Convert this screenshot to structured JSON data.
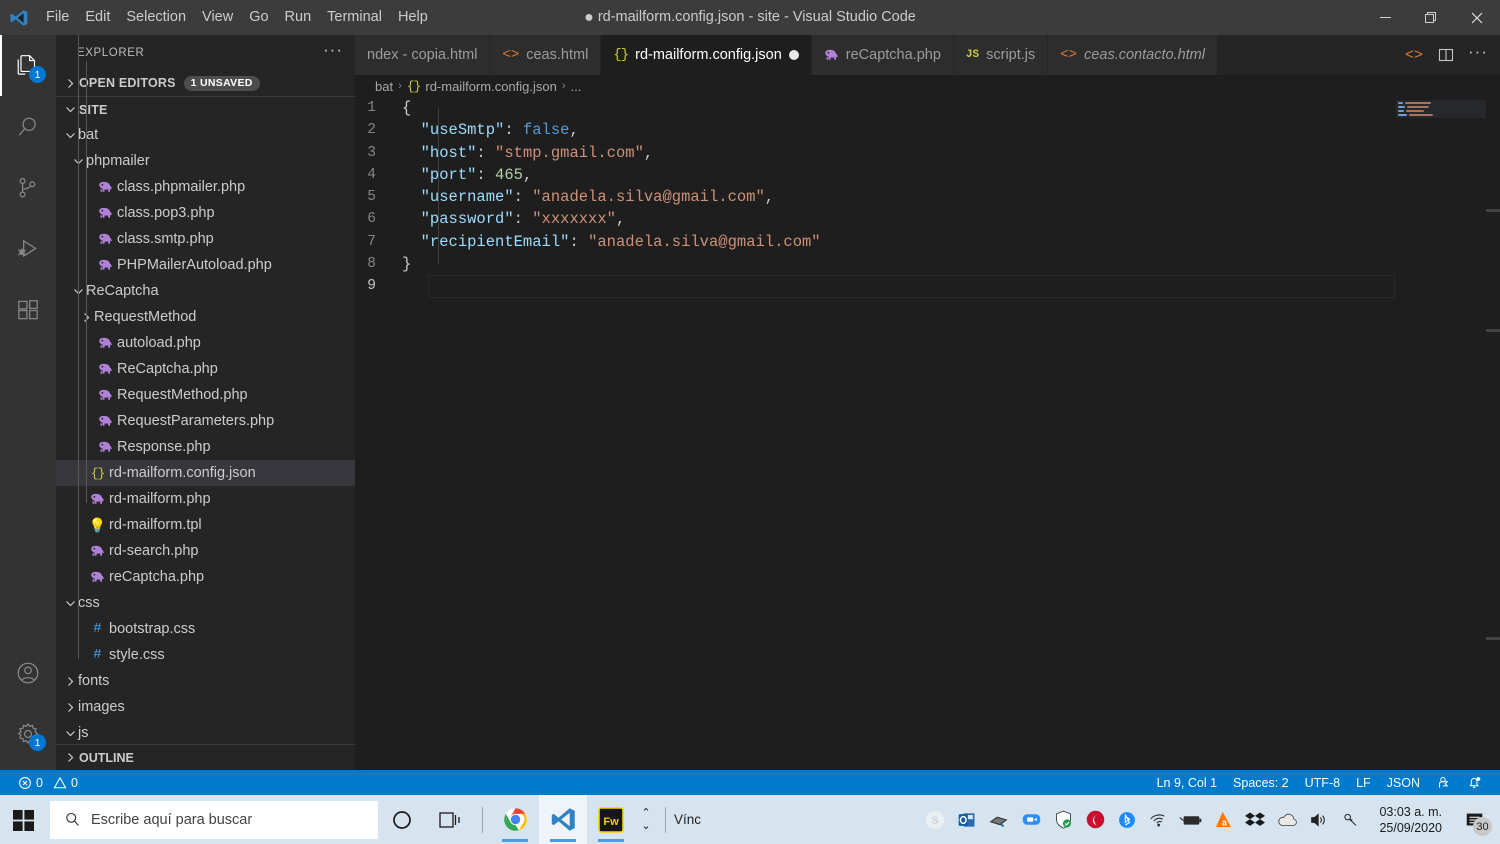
{
  "window": {
    "title": "rd-mailform.config.json - site - Visual Studio Code",
    "dirty_marker": "●",
    "minimize": "─",
    "restore": "❐",
    "close": "✕"
  },
  "menubar": {
    "items": [
      "File",
      "Edit",
      "Selection",
      "View",
      "Go",
      "Run",
      "Terminal",
      "Help"
    ]
  },
  "activitybar": {
    "items": [
      {
        "name": "explorer",
        "badge": "1",
        "active": true
      },
      {
        "name": "search",
        "badge": "",
        "active": false
      },
      {
        "name": "source-control",
        "badge": "",
        "active": false
      },
      {
        "name": "run-and-debug",
        "badge": "",
        "active": false
      },
      {
        "name": "extensions",
        "badge": "",
        "active": false
      }
    ],
    "bottom": [
      {
        "name": "accounts",
        "badge": ""
      },
      {
        "name": "manage-settings",
        "badge": "1"
      }
    ]
  },
  "sidebar": {
    "title": "EXPLORER",
    "more_actions": "···",
    "open_editors": {
      "label": "OPEN EDITORS",
      "chip": "1 UNSAVED",
      "expanded": false
    },
    "root": {
      "label": "SITE",
      "expanded": true
    },
    "outline": {
      "label": "OUTLINE",
      "expanded": false
    },
    "tree": [
      {
        "label": "bat",
        "type": "folder",
        "expanded": true,
        "depth": 1
      },
      {
        "label": "phpmailer",
        "type": "folder",
        "expanded": true,
        "depth": 2
      },
      {
        "label": "class.phpmailer.php",
        "type": "php",
        "depth": 3
      },
      {
        "label": "class.pop3.php",
        "type": "php",
        "depth": 3
      },
      {
        "label": "class.smtp.php",
        "type": "php",
        "depth": 3
      },
      {
        "label": "PHPMailerAutoload.php",
        "type": "php",
        "depth": 3
      },
      {
        "label": "ReCaptcha",
        "type": "folder",
        "expanded": true,
        "depth": 2
      },
      {
        "label": "RequestMethod",
        "type": "folder",
        "expanded": false,
        "depth": 3
      },
      {
        "label": "autoload.php",
        "type": "php",
        "depth": 3
      },
      {
        "label": "ReCaptcha.php",
        "type": "php",
        "depth": 3
      },
      {
        "label": "RequestMethod.php",
        "type": "php",
        "depth": 3
      },
      {
        "label": "RequestParameters.php",
        "type": "php",
        "depth": 3
      },
      {
        "label": "Response.php",
        "type": "php",
        "depth": 3
      },
      {
        "label": "rd-mailform.config.json",
        "type": "json",
        "depth": 2,
        "selected": true
      },
      {
        "label": "rd-mailform.php",
        "type": "php",
        "depth": 2
      },
      {
        "label": "rd-mailform.tpl",
        "type": "tpl",
        "depth": 2
      },
      {
        "label": "rd-search.php",
        "type": "php",
        "depth": 2
      },
      {
        "label": "reCaptcha.php",
        "type": "php",
        "depth": 2
      },
      {
        "label": "css",
        "type": "folder",
        "expanded": true,
        "depth": 1
      },
      {
        "label": "bootstrap.css",
        "type": "css",
        "depth": 2
      },
      {
        "label": "style.css",
        "type": "css",
        "depth": 2
      },
      {
        "label": "fonts",
        "type": "folder",
        "expanded": false,
        "depth": 1
      },
      {
        "label": "images",
        "type": "folder",
        "expanded": false,
        "depth": 1
      },
      {
        "label": "js",
        "type": "folder",
        "expanded": true,
        "depth": 1
      }
    ]
  },
  "tabs": [
    {
      "label": "ndex - copia.html",
      "icon": "html",
      "active": false,
      "dirty": false,
      "italic": false,
      "clipped": true
    },
    {
      "label": "ceas.html",
      "icon": "html",
      "active": false,
      "dirty": false,
      "italic": false
    },
    {
      "label": "rd-mailform.config.json",
      "icon": "json",
      "active": true,
      "dirty": true,
      "italic": false
    },
    {
      "label": "reCaptcha.php",
      "icon": "php",
      "active": false,
      "dirty": false,
      "italic": false
    },
    {
      "label": "script.js",
      "icon": "js",
      "active": false,
      "dirty": false,
      "italic": false
    },
    {
      "label": "ceas.contacto.html",
      "icon": "html",
      "active": false,
      "dirty": false,
      "italic": true
    }
  ],
  "tab_actions": {
    "open_changes": "‹›",
    "split_editor": "split-editor-icon",
    "more": "···"
  },
  "breadcrumb": {
    "parts": [
      "bat",
      "rd-mailform.config.json",
      "..."
    ],
    "separator": "›"
  },
  "editor": {
    "language": "JSON",
    "lines": [
      {
        "no": 1,
        "tokens": [
          {
            "t": "{",
            "c": "brace"
          }
        ]
      },
      {
        "no": 2,
        "tokens": [
          {
            "t": "  ",
            "c": "plain"
          },
          {
            "t": "\"useSmtp\"",
            "c": "key"
          },
          {
            "t": ":",
            "c": "colon"
          },
          {
            "t": " ",
            "c": "plain"
          },
          {
            "t": "false",
            "c": "bool"
          },
          {
            "t": ",",
            "c": "comma"
          }
        ]
      },
      {
        "no": 3,
        "tokens": [
          {
            "t": "  ",
            "c": "plain"
          },
          {
            "t": "\"host\"",
            "c": "key"
          },
          {
            "t": ":",
            "c": "colon"
          },
          {
            "t": " ",
            "c": "plain"
          },
          {
            "t": "\"stmp.gmail.com\"",
            "c": "str"
          },
          {
            "t": ",",
            "c": "comma"
          }
        ]
      },
      {
        "no": 4,
        "tokens": [
          {
            "t": "  ",
            "c": "plain"
          },
          {
            "t": "\"port\"",
            "c": "key"
          },
          {
            "t": ":",
            "c": "colon"
          },
          {
            "t": " ",
            "c": "plain"
          },
          {
            "t": "465",
            "c": "num"
          },
          {
            "t": ",",
            "c": "comma"
          }
        ]
      },
      {
        "no": 5,
        "tokens": [
          {
            "t": "  ",
            "c": "plain"
          },
          {
            "t": "\"username\"",
            "c": "key"
          },
          {
            "t": ":",
            "c": "colon"
          },
          {
            "t": " ",
            "c": "plain"
          },
          {
            "t": "\"anadela.silva@gmail.com\"",
            "c": "str"
          },
          {
            "t": ",",
            "c": "comma"
          }
        ]
      },
      {
        "no": 6,
        "tokens": [
          {
            "t": "  ",
            "c": "plain"
          },
          {
            "t": "\"password\"",
            "c": "key"
          },
          {
            "t": ":",
            "c": "colon"
          },
          {
            "t": " ",
            "c": "plain"
          },
          {
            "t": "\"xxxxxxx\"",
            "c": "str"
          },
          {
            "t": ",",
            "c": "comma"
          }
        ]
      },
      {
        "no": 7,
        "tokens": [
          {
            "t": "  ",
            "c": "plain"
          },
          {
            "t": "\"recipientEmail\"",
            "c": "key"
          },
          {
            "t": ":",
            "c": "colon"
          },
          {
            "t": " ",
            "c": "plain"
          },
          {
            "t": "\"anadela.silva@gmail.com\"",
            "c": "str"
          }
        ]
      },
      {
        "no": 8,
        "tokens": [
          {
            "t": "}",
            "c": "brace"
          }
        ]
      },
      {
        "no": 9,
        "tokens": [],
        "current": true
      }
    ]
  },
  "statusbar": {
    "errors": "0",
    "warnings": "0",
    "position": "Ln 9, Col 1",
    "indentation": "Spaces: 2",
    "encoding": "UTF-8",
    "eol": "LF",
    "language": "JSON",
    "feedback_icon": "tweet-feedback-icon",
    "bell_icon": "bell-dot-icon"
  },
  "taskbar": {
    "start": "windows-logo",
    "search_placeholder": "Escribe aquí para buscar",
    "cortana": "cortana-icon",
    "task_view": "task-view-icon",
    "pinned": [
      {
        "name": "google-chrome",
        "running": true
      },
      {
        "name": "visual-studio-code",
        "running": true,
        "active": true
      },
      {
        "name": "adobe-fireworks",
        "running": true
      }
    ],
    "overflow_up": "⌃",
    "overflow_down": "⌄",
    "vinc_label": "Vínc",
    "tray": [
      "skype-icon",
      "outlook-icon",
      "printer-icon",
      "zoom-icon",
      "windows-security-icon",
      "antivirus-icon",
      "bluetooth-icon",
      "wifi-icon",
      "battery-icon",
      "avast-icon",
      "dropbox-icon",
      "onedrive-icon",
      "volume-icon",
      "bluetooth-link-icon"
    ],
    "clock_time": "03:03 a. m.",
    "clock_date": "25/09/2020",
    "notifications_count": "30"
  },
  "colors": {
    "accent": "#007acc",
    "titlebar": "#3c3c3c",
    "sidebar": "#252526",
    "editor": "#1e1e1e",
    "activitybar": "#333333",
    "taskbar": "#d6e4f0"
  }
}
